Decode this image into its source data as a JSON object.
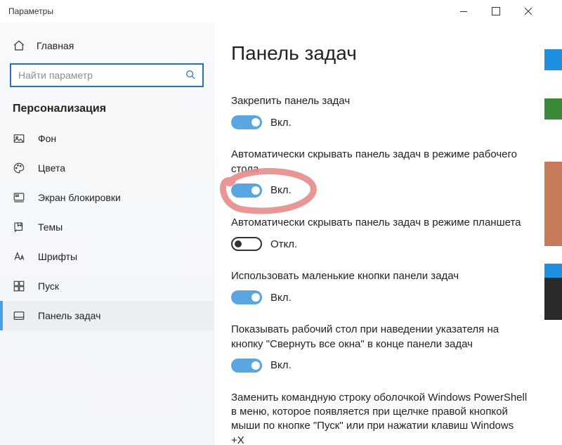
{
  "window": {
    "title": "Параметры"
  },
  "sidebar": {
    "home": "Главная",
    "search_placeholder": "Найти параметр",
    "section": "Персонализация",
    "items": [
      {
        "label": "Фон"
      },
      {
        "label": "Цвета"
      },
      {
        "label": "Экран блокировки"
      },
      {
        "label": "Темы"
      },
      {
        "label": "Шрифты"
      },
      {
        "label": "Пуск"
      },
      {
        "label": "Панель задач"
      }
    ]
  },
  "content": {
    "title": "Панель задач",
    "settings": [
      {
        "label": "Закрепить панель задач",
        "state": "Вкл.",
        "on": true
      },
      {
        "label": "Автоматически скрывать панель задач в режиме рабочего стола",
        "state": "Вкл.",
        "on": true
      },
      {
        "label": "Автоматически скрывать панель задач в режиме планшета",
        "state": "Откл.",
        "on": false
      },
      {
        "label": "Использовать маленькие кнопки панели задач",
        "state": "Вкл.",
        "on": true
      },
      {
        "label": "Показывать рабочий стол при наведении указателя на кнопку \"Свернуть все окна\" в конце панели задач",
        "state": "Вкл.",
        "on": true
      },
      {
        "label": "Заменить командную строку оболочкой Windows PowerShell в меню, которое появляется при щелчке правой кнопкой мыши по кнопке \"Пуск\" или при нажатии клавиш Windows +X",
        "state": "",
        "on": null
      }
    ]
  }
}
